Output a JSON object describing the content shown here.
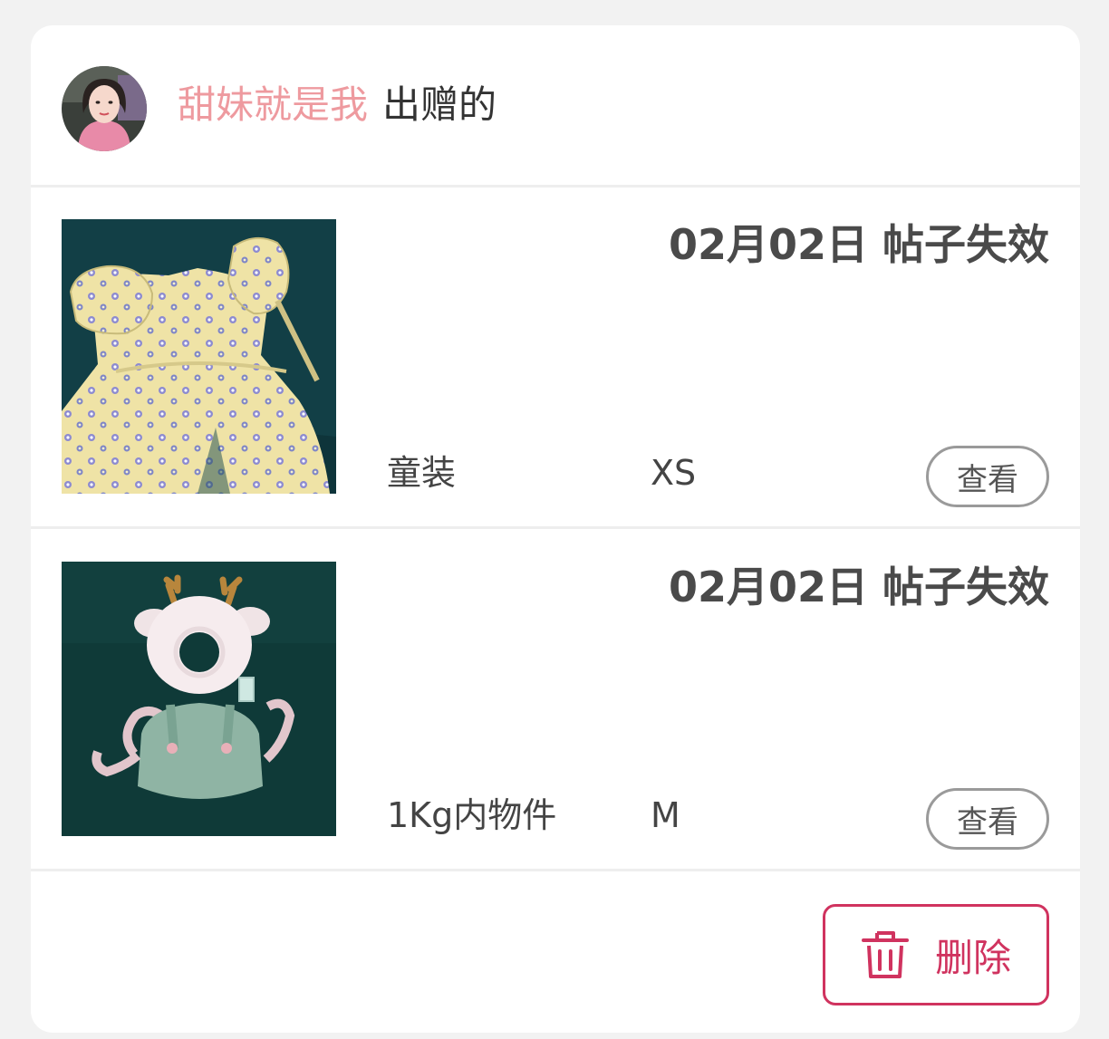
{
  "header": {
    "username": "甜妹就是我",
    "action_label": "出赠的"
  },
  "items": [
    {
      "status": "02月02日 帖子失效",
      "category": "童装",
      "size": "XS",
      "view_label": "查看",
      "image_icon": "floral-baby-dress-photo"
    },
    {
      "status": "02月02日 帖子失效",
      "category": "1Kg内物件",
      "size": "M",
      "view_label": "查看",
      "image_icon": "deer-head-protector-photo"
    }
  ],
  "footer": {
    "delete_label": "删除",
    "delete_icon": "trash-icon"
  },
  "colors": {
    "username": "#ee9a9f",
    "delete_accent": "#d0335f",
    "status_text": "#4a4a4a"
  }
}
